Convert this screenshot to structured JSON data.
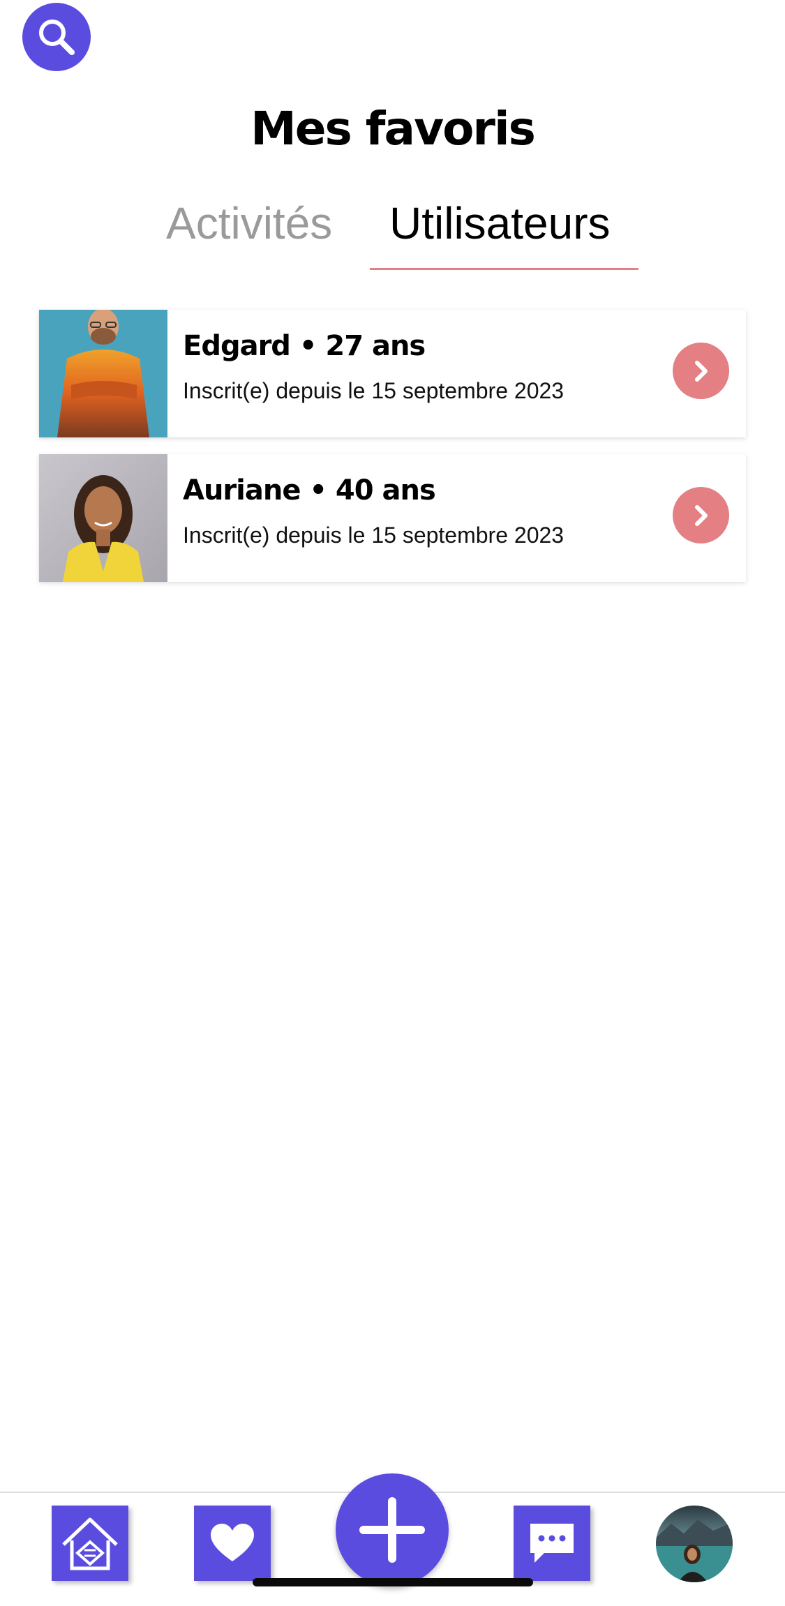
{
  "header": {
    "title": "Mes favoris",
    "search_icon": "search-icon"
  },
  "tabs": [
    {
      "label": "Activités",
      "active": false
    },
    {
      "label": "Utilisateurs",
      "active": true
    }
  ],
  "users": [
    {
      "name": "Edgard • 27 ans",
      "subtitle": "Inscrit(e) depuis le 15 septembre 2023"
    },
    {
      "name": "Auriane • 40 ans",
      "subtitle": "Inscrit(e) depuis le 15 septembre 2023"
    }
  ],
  "nav": {
    "items": [
      "home-icon",
      "heart-icon",
      "plus-icon",
      "chat-icon",
      "profile-avatar"
    ]
  },
  "colors": {
    "primary": "#5b4ce0",
    "accent": "#e47f83",
    "tab_inactive": "#9a9a9a"
  }
}
